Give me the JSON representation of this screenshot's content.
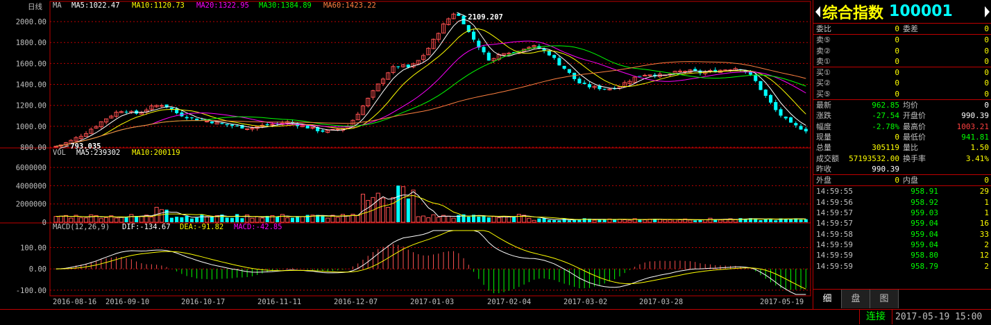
{
  "chart_panel": {
    "period_label": "日线",
    "ma_indicator": "MA",
    "ma_legend": [
      {
        "text": "MA5:1022.47",
        "color": "#ffffff"
      },
      {
        "text": "MA10:1120.73",
        "color": "#ffff00"
      },
      {
        "text": "MA20:1322.95",
        "color": "#ff00ff"
      },
      {
        "text": "MA30:1384.89",
        "color": "#00ff00"
      },
      {
        "text": "MA60:1423.22",
        "color": "#ff8040"
      }
    ],
    "high_label": "2109.207",
    "low_label": "793.035",
    "price_ticks": [
      "2000.00",
      "1800.00",
      "1600.00",
      "1400.00",
      "1200.00",
      "1000.00",
      "800.00"
    ],
    "vol_indicator": "VOL",
    "vol_legend": [
      {
        "text": "MA5:239302",
        "color": "#ffffff"
      },
      {
        "text": "MA10:200119",
        "color": "#ffff00"
      }
    ],
    "vol_ticks": [
      "6000000",
      "4000000",
      "2000000",
      "0"
    ],
    "macd_indicator": "MACD(12,26,9)",
    "macd_legend": [
      {
        "text": "DIF:-134.67",
        "color": "#ffffff"
      },
      {
        "text": "DEA:-91.82",
        "color": "#ffff00"
      },
      {
        "text": "MACD:-42.85",
        "color": "#ff00ff"
      }
    ],
    "macd_ticks": [
      "100.00",
      "0.00",
      "-100.00"
    ],
    "date_labels": [
      "2016-08-16",
      "2016-09-10",
      "2016-10-17",
      "2016-11-11",
      "2016-12-07",
      "2017-01-03",
      "2017-02-04",
      "2017-03-02",
      "2017-03-28",
      "2017-05-19"
    ]
  },
  "chart_data": {
    "type": "candlestick",
    "price_range": [
      793.035,
      2109.207
    ],
    "close_path": [
      810,
      830,
      860,
      900,
      940,
      990,
      1040,
      1090,
      1130,
      1160,
      1130,
      1120,
      1160,
      1190,
      1210,
      1180,
      1130,
      1100,
      1080,
      1060,
      1050,
      1040,
      1020,
      1010,
      1000,
      990,
      980,
      1000,
      1010,
      1020,
      1030,
      1040,
      1020,
      1000,
      980,
      960,
      950,
      960,
      980,
      1000,
      1100,
      1200,
      1300,
      1400,
      1500,
      1560,
      1580,
      1560,
      1600,
      1680,
      1780,
      1900,
      2000,
      2080,
      2040,
      1900,
      1800,
      1700,
      1620,
      1680,
      1720,
      1700,
      1740,
      1760,
      1760,
      1720,
      1680,
      1600,
      1540,
      1460,
      1400,
      1380,
      1370,
      1360,
      1360,
      1380,
      1420,
      1460,
      1490,
      1500,
      1490,
      1480,
      1500,
      1520,
      1530,
      1520,
      1510,
      1520,
      1530,
      1540,
      1550,
      1560,
      1520,
      1460,
      1350,
      1250,
      1150,
      1080,
      1020,
      990,
      962.85
    ],
    "volume_scale_max": 7000000,
    "macd_range": [
      -120,
      180
    ]
  },
  "quote": {
    "name": "综合指数",
    "code": "100001",
    "book_top": [
      {
        "l": "委比",
        "v": "0",
        "l2": "委差",
        "v2": "0"
      }
    ],
    "asks": [
      {
        "l": "卖⑤",
        "v": "0",
        "v2": "0"
      },
      {
        "l": "卖②",
        "v": "0",
        "v2": "0"
      },
      {
        "l": "卖①",
        "v": "0",
        "v2": "0"
      }
    ],
    "bids": [
      {
        "l": "买①",
        "v": "0",
        "v2": "0"
      },
      {
        "l": "买②",
        "v": "0",
        "v2": "0"
      },
      {
        "l": "买⑤",
        "v": "0",
        "v2": "0"
      }
    ],
    "stats": [
      {
        "l": "最新",
        "v": "962.85",
        "c": "#00ff00",
        "l2": "均价",
        "v2": "0",
        "c2": "#ffffff"
      },
      {
        "l": "涨跌",
        "v": "-27.54",
        "c": "#00ff00",
        "l2": "开盘价",
        "v2": "990.39",
        "c2": "#ffffff"
      },
      {
        "l": "幅度",
        "v": "-2.78%",
        "c": "#00ff00",
        "l2": "最高价",
        "v2": "1003.21",
        "c2": "#ff4040"
      },
      {
        "l": "现量",
        "v": "0",
        "c": "#ffff00",
        "l2": "最低价",
        "v2": "941.81",
        "c2": "#00ff00"
      },
      {
        "l": "总量",
        "v": "305119",
        "c": "#ffff00",
        "l2": "量比",
        "v2": "1.50",
        "c2": "#ffff00"
      },
      {
        "l": "成交额",
        "v": "57193532.00",
        "c": "#ffff00",
        "l2": "换手率",
        "v2": "3.41%",
        "c2": "#ffff00"
      },
      {
        "l": "昨收",
        "v": "990.39",
        "c": "#ffffff",
        "l2": "",
        "v2": "",
        "c2": "#ffffff"
      }
    ],
    "outer_inner": {
      "l": "外盘",
      "v": "0",
      "l2": "内盘",
      "v2": "0"
    },
    "ticks": [
      {
        "t": "14:59:55",
        "p": "958.91",
        "q": "29"
      },
      {
        "t": "14:59:56",
        "p": "958.92",
        "q": "1"
      },
      {
        "t": "14:59:57",
        "p": "959.03",
        "q": "1"
      },
      {
        "t": "14:59:57",
        "p": "959.04",
        "q": "16"
      },
      {
        "t": "14:59:58",
        "p": "959.04",
        "q": "33"
      },
      {
        "t": "14:59:59",
        "p": "959.04",
        "q": "2"
      },
      {
        "t": "14:59:59",
        "p": "958.80",
        "q": "12"
      },
      {
        "t": "14:59:59",
        "p": "958.79",
        "q": "2"
      }
    ],
    "tabs": [
      "细",
      "盘",
      "图"
    ]
  },
  "status": {
    "connection": "连接",
    "datetime": "2017-05-19 15:00"
  },
  "colors": {
    "up": "#ff5050",
    "down": "#00ffff",
    "grid": "#c00000",
    "tick_price": "#00ff00"
  }
}
